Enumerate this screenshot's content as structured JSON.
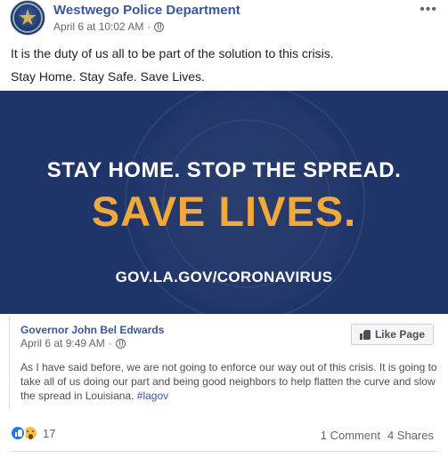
{
  "post": {
    "page_name": "Westwego Police Department",
    "timestamp": "April 6 at 10:02 AM",
    "separator": "·",
    "privacy_icon": "globe-icon",
    "more_icon": "•••",
    "text_line1": "It is the duty of us all to be part of the solution to this crisis.",
    "text_line2": "Stay Home. Stay Safe. Save Lives."
  },
  "banner": {
    "line1": "STAY HOME. STOP THE SPREAD.",
    "line2": "SAVE LIVES.",
    "line3": "GOV.LA.GOV/CORONAVIRUS",
    "bg_color": "#1f3468",
    "accent_color": "#f0a93b"
  },
  "shared_post": {
    "author": "Governor John Bel Edwards",
    "timestamp": "April 6 at 9:49 AM",
    "separator": "·",
    "like_page_label": "Like Page",
    "text": "As I have said before, we are not going to enforce our way out of this crisis. It is going to take all of us doing our part and being good neighbors to help flatten the curve and slow the spread in Louisiana.",
    "hashtag": "#lagov"
  },
  "footer": {
    "reaction_count": "17",
    "comments": "1 Comment",
    "shares": "4 Shares"
  }
}
